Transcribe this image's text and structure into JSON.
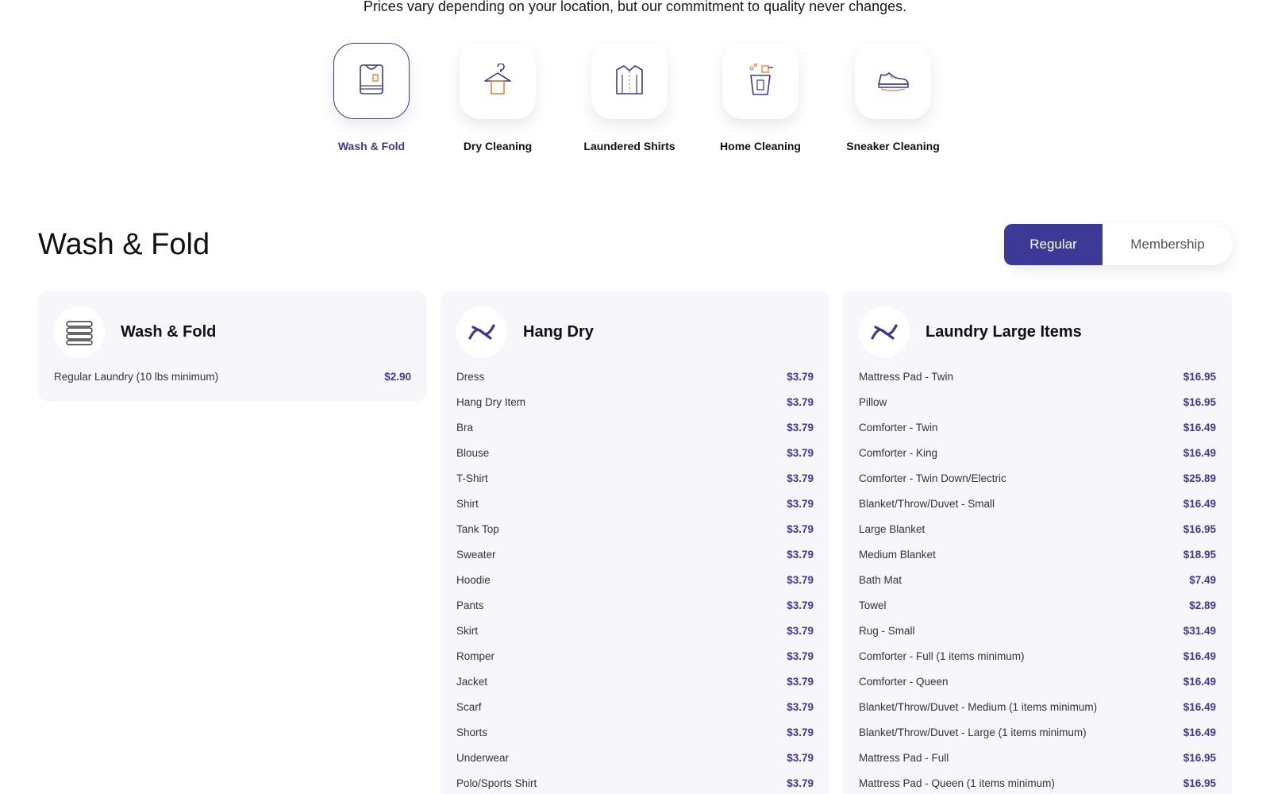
{
  "tagline": "Prices vary depending on your location, but our commitment to quality never changes.",
  "services": [
    {
      "label": "Wash & Fold",
      "icon": "laundry-bag-icon",
      "active": true
    },
    {
      "label": "Dry Cleaning",
      "icon": "hanger-icon",
      "active": false
    },
    {
      "label": "Laundered Shirts",
      "icon": "shirt-icon",
      "active": false
    },
    {
      "label": "Home Cleaning",
      "icon": "cleaning-bucket-icon",
      "active": false
    },
    {
      "label": "Sneaker Cleaning",
      "icon": "sneaker-icon",
      "active": false
    }
  ],
  "section_title": "Wash & Fold",
  "pricing_toggle": {
    "regular": "Regular",
    "membership": "Membership",
    "selected": "Regular"
  },
  "colors": {
    "accent": "#3d3a97",
    "orange": "#e8843a",
    "card_bg": "#f7f7fb"
  },
  "cards": {
    "wash_fold": {
      "title": "Wash & Fold",
      "icon": "folded-clothes-icon",
      "items": [
        {
          "name": "Regular Laundry (10 lbs minimum)",
          "price": "$2.90"
        }
      ]
    },
    "hang_dry": {
      "title": "Hang Dry",
      "icon": "brand-logo-icon",
      "items": [
        {
          "name": "Dress",
          "price": "$3.79"
        },
        {
          "name": "Hang Dry Item",
          "price": "$3.79"
        },
        {
          "name": "Bra",
          "price": "$3.79"
        },
        {
          "name": "Blouse",
          "price": "$3.79"
        },
        {
          "name": "T-Shirt",
          "price": "$3.79"
        },
        {
          "name": "Shirt",
          "price": "$3.79"
        },
        {
          "name": "Tank Top",
          "price": "$3.79"
        },
        {
          "name": "Sweater",
          "price": "$3.79"
        },
        {
          "name": "Hoodie",
          "price": "$3.79"
        },
        {
          "name": "Pants",
          "price": "$3.79"
        },
        {
          "name": "Skirt",
          "price": "$3.79"
        },
        {
          "name": "Romper",
          "price": "$3.79"
        },
        {
          "name": "Jacket",
          "price": "$3.79"
        },
        {
          "name": "Scarf",
          "price": "$3.79"
        },
        {
          "name": "Shorts",
          "price": "$3.79"
        },
        {
          "name": "Underwear",
          "price": "$3.79"
        },
        {
          "name": "Polo/Sports Shirt",
          "price": "$3.79"
        }
      ]
    },
    "laundry_large": {
      "title": "Laundry Large Items",
      "icon": "brand-logo-icon",
      "items": [
        {
          "name": "Mattress Pad - Twin",
          "price": "$16.95"
        },
        {
          "name": "Pillow",
          "price": "$16.95"
        },
        {
          "name": "Comforter - Twin",
          "price": "$16.49"
        },
        {
          "name": "Comforter - King",
          "price": "$16.49"
        },
        {
          "name": "Comforter - Twin Down/Electric",
          "price": "$25.89"
        },
        {
          "name": "Blanket/Throw/Duvet - Small",
          "price": "$16.49"
        },
        {
          "name": "Large Blanket",
          "price": "$16.95"
        },
        {
          "name": "Medium Blanket",
          "price": "$18.95"
        },
        {
          "name": "Bath Mat",
          "price": "$7.49"
        },
        {
          "name": "Towel",
          "price": "$2.89"
        },
        {
          "name": "Rug - Small",
          "price": "$31.49"
        },
        {
          "name": "Comforter - Full (1 items minimum)",
          "price": "$16.49"
        },
        {
          "name": "Comforter - Queen",
          "price": "$16.49"
        },
        {
          "name": "Blanket/Throw/Duvet - Medium (1 items minimum)",
          "price": "$16.49"
        },
        {
          "name": "Blanket/Throw/Duvet - Large (1 items minimum)",
          "price": "$16.49"
        },
        {
          "name": "Mattress Pad - Full",
          "price": "$16.95"
        },
        {
          "name": "Mattress Pad - Queen (1 items minimum)",
          "price": "$16.95"
        }
      ]
    }
  }
}
